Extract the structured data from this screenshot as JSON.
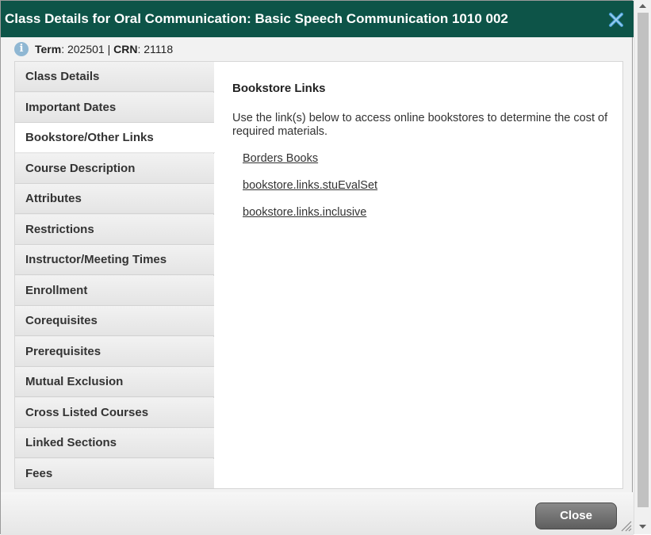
{
  "dialog": {
    "title": "Class Details for Oral Communication: Basic Speech Communication 1010 002",
    "close_icon": "close-x-icon"
  },
  "info": {
    "icon": "info-icon",
    "term_label": "Term",
    "term_value": "202501",
    "separator": "|",
    "crn_label": "CRN",
    "crn_value": "21118"
  },
  "nav": {
    "items": [
      {
        "label": "Class Details",
        "active": false
      },
      {
        "label": "Important Dates",
        "active": false
      },
      {
        "label": "Bookstore/Other Links",
        "active": true
      },
      {
        "label": "Course Description",
        "active": false
      },
      {
        "label": "Attributes",
        "active": false
      },
      {
        "label": "Restrictions",
        "active": false
      },
      {
        "label": "Instructor/Meeting Times",
        "active": false
      },
      {
        "label": "Enrollment",
        "active": false
      },
      {
        "label": "Corequisites",
        "active": false
      },
      {
        "label": "Prerequisites",
        "active": false
      },
      {
        "label": "Mutual Exclusion",
        "active": false
      },
      {
        "label": "Cross Listed Courses",
        "active": false
      },
      {
        "label": "Linked Sections",
        "active": false
      },
      {
        "label": "Fees",
        "active": false
      }
    ]
  },
  "content": {
    "title": "Bookstore Links",
    "description": "Use the link(s) below to access online bookstores to determine the cost of required materials.",
    "links": [
      "Borders Books",
      "bookstore.links.stuEvalSet",
      "bookstore.links.inclusive"
    ]
  },
  "footer": {
    "close_label": "Close"
  },
  "colors": {
    "titlebar": "#0d5448",
    "close_x": "#4aa0d8"
  }
}
